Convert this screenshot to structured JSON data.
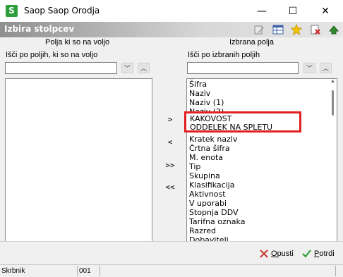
{
  "window": {
    "title": "Saop Saop Orodja",
    "app_icon_letter": "S",
    "minimize_glyph": "—",
    "maximize_glyph": "☐",
    "close_glyph": "✕"
  },
  "header": {
    "title": "Izbira stolpcev",
    "toolbar_icons": [
      "edit-icon",
      "columns-icon",
      "star-icon",
      "delete-icon",
      "exit-icon"
    ]
  },
  "left_panel": {
    "heading": "Polja ki so na voljo",
    "search_label": "Išči po poljih, ki so na voljo",
    "search_value": "",
    "items": []
  },
  "right_panel": {
    "heading": "Izbrana polja",
    "search_label": "Išči po izbranih poljih",
    "search_value": "",
    "items_top": [
      "Šifra",
      "Naziv",
      "Naziv (1)",
      "Naziv (2)"
    ],
    "highlighted": [
      "KAKOVOST",
      "ODDELEK NA SPLETU"
    ],
    "items_bottom": [
      "Kratek naziv",
      "Črtna šifra",
      "M. enota",
      "Tip",
      "Skupina",
      "Klasifikacija",
      "Aktivnost",
      "V uporabi",
      "Stopnja DDV",
      "Tarifna oznaka",
      "Razred",
      "Dobavitelj"
    ]
  },
  "move_buttons": {
    "add": ">",
    "remove": "<",
    "add_all": ">>",
    "remove_all": "<<"
  },
  "footer": {
    "cancel_label_prefix": "O",
    "cancel_label_rest": "pusti",
    "ok_label_prefix": "P",
    "ok_label_rest": "otrdi",
    "cancel_color": "#c0392b",
    "ok_color": "#2e9e3c"
  },
  "status": {
    "user": "Skrbnik",
    "code": "001"
  }
}
